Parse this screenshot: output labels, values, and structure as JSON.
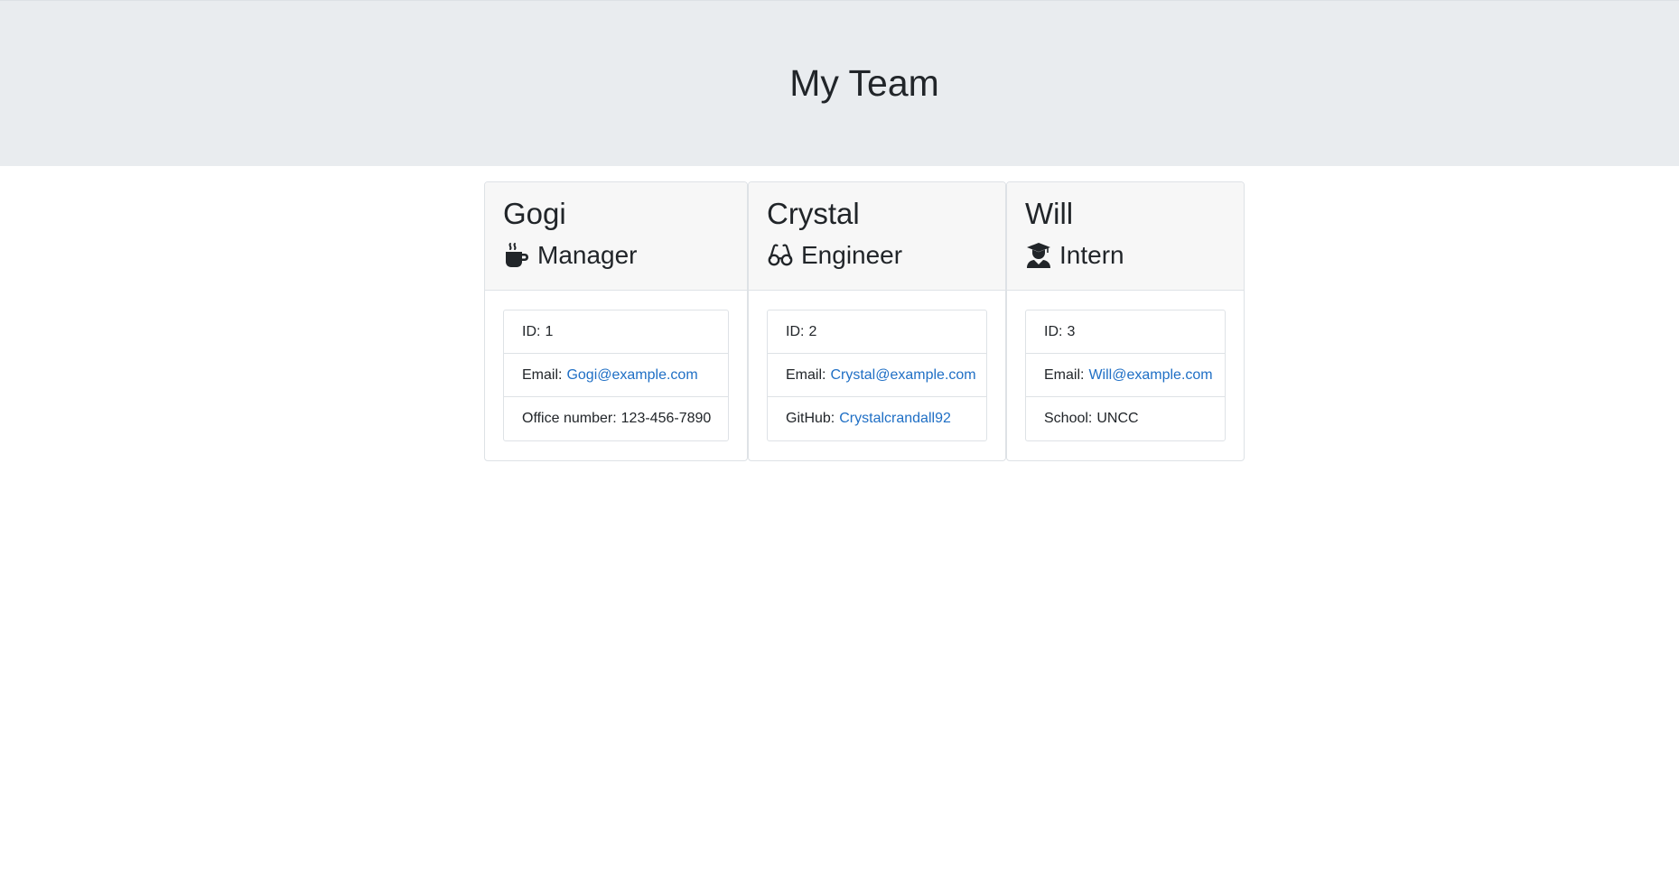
{
  "header": {
    "title": "My Team"
  },
  "colors": {
    "header_bg": "#e9ecef",
    "link": "#1f6fc5",
    "card_header_bg": "#f7f7f7"
  },
  "cards": [
    {
      "name": "Gogi",
      "role": "Manager",
      "role_icon": "coffee-mug-icon",
      "id_label": "ID:",
      "id_value": "1",
      "email_label": "Email:",
      "email": "Gogi@example.com",
      "extra_label": "Office number:",
      "extra_value": "123-456-7890"
    },
    {
      "name": "Crystal",
      "role": "Engineer",
      "role_icon": "glasses-icon",
      "id_label": "ID:",
      "id_value": "2",
      "email_label": "Email:",
      "email": "Crystal@example.com",
      "extra_label": "GitHub:",
      "extra_value": "Crystalcrandall92"
    },
    {
      "name": "Will",
      "role": "Intern",
      "role_icon": "graduate-icon",
      "id_label": "ID:",
      "id_value": "3",
      "email_label": "Email:",
      "email": "Will@example.com",
      "extra_label": "School:",
      "extra_value": "UNCC"
    }
  ]
}
